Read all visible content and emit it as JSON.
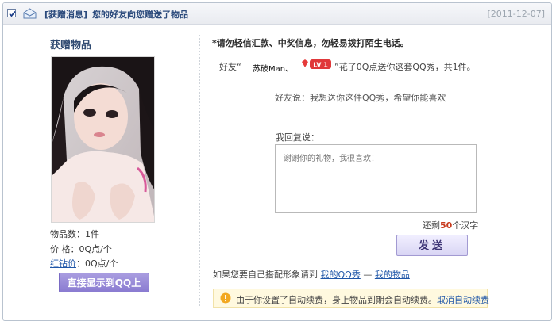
{
  "header": {
    "tag": "[获赠消息]",
    "title": "您的好友向您赠送了物品",
    "date": "[2011-12-07]"
  },
  "left": {
    "title": "获赠物品",
    "count_label": "物品数：",
    "count_value": "1件",
    "price_label": "价  格：",
    "price_value": "0Q点/个",
    "diamond_label": "红钻价",
    "diamond_value": "：0Q点/个",
    "button_label": "直接显示到QQ上"
  },
  "right": {
    "warning": "*请勿轻信汇款、中奖信息，勿轻易拨打陌生电话。",
    "friend_prefix": "好友“",
    "friend_name": "苏破Man、",
    "level_badge": "LV 1",
    "friend_suffix": "”花了0Q点送你这套QQ秀，共1件。",
    "friend_says": "好友说：我想送你这件QQ秀，希望你能喜欢",
    "reply_label": "我回复说：",
    "reply_placeholder": "谢谢你的礼物，我很喜欢！",
    "remain_prefix": "还剩",
    "remain_count": "50",
    "remain_suffix": "个汉字",
    "send_label": "发送",
    "link_prefix": "如果您要自己搭配形象请到 ",
    "link_qqshow": "我的QQ秀",
    "link_sep": " — ",
    "link_items": "我的物品",
    "notice_text": "由于你设置了自动续费，身上物品到期会自动续费。",
    "notice_link": "取消自动续费"
  },
  "colors": {
    "accent": "#2b4a7c",
    "button_purple": "#8a7bd1",
    "notice_bg": "#fff9df",
    "highlight_red": "#c83a1d"
  }
}
